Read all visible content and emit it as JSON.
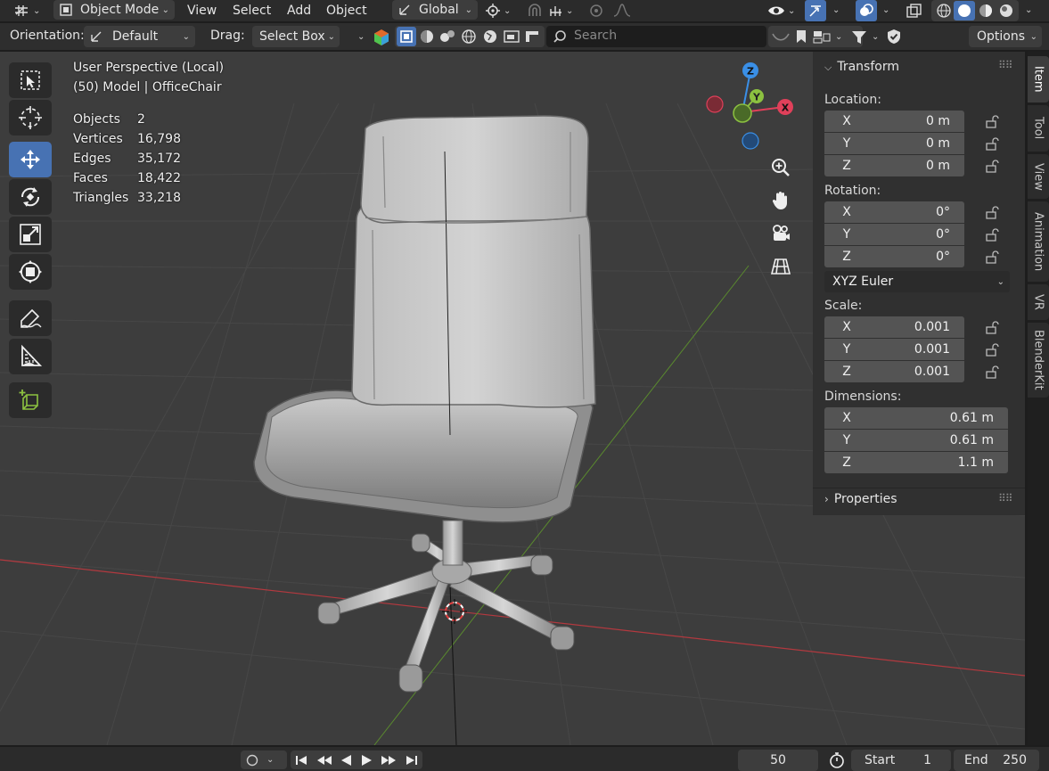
{
  "header": {
    "mode": "Object Mode",
    "menus": [
      "View",
      "Select",
      "Add",
      "Object"
    ],
    "transform_orientation": "Global"
  },
  "toolsettings": {
    "orientation_label": "Orientation:",
    "orientation_value": "Default",
    "drag_label": "Drag:",
    "drag_value": "Select Box",
    "search_placeholder": "Search",
    "options_label": "Options"
  },
  "viewport": {
    "view_name": "User Perspective (Local)",
    "object_info": "(50) Model | OfficeChair",
    "stats": [
      {
        "label": "Objects",
        "value": "2"
      },
      {
        "label": "Vertices",
        "value": "16,798"
      },
      {
        "label": "Edges",
        "value": "35,172"
      },
      {
        "label": "Faces",
        "value": "18,422"
      },
      {
        "label": "Triangles",
        "value": "33,218"
      }
    ],
    "gizmo": {
      "z": "Z",
      "y": "Y",
      "x": "X"
    }
  },
  "npanel": {
    "transform_title": "Transform",
    "location_label": "Location:",
    "location": [
      {
        "axis": "X",
        "value": "0 m"
      },
      {
        "axis": "Y",
        "value": "0 m"
      },
      {
        "axis": "Z",
        "value": "0 m"
      }
    ],
    "rotation_label": "Rotation:",
    "rotation": [
      {
        "axis": "X",
        "value": "0°"
      },
      {
        "axis": "Y",
        "value": "0°"
      },
      {
        "axis": "Z",
        "value": "0°"
      }
    ],
    "rotation_mode": "XYZ Euler",
    "scale_label": "Scale:",
    "scale": [
      {
        "axis": "X",
        "value": "0.001"
      },
      {
        "axis": "Y",
        "value": "0.001"
      },
      {
        "axis": "Z",
        "value": "0.001"
      }
    ],
    "dimensions_label": "Dimensions:",
    "dimensions": [
      {
        "axis": "X",
        "value": "0.61 m"
      },
      {
        "axis": "Y",
        "value": "0.61 m"
      },
      {
        "axis": "Z",
        "value": "1.1 m"
      }
    ],
    "properties_title": "Properties"
  },
  "sidebar_tabs": [
    "Item",
    "Tool",
    "View",
    "Animation",
    "VR",
    "BlenderKit"
  ],
  "timeline": {
    "current_frame": "50",
    "start_label": "Start",
    "start_value": "1",
    "end_label": "End",
    "end_value": "250"
  },
  "colors": {
    "accent": "#4772b3",
    "axis_x": "#e0405a",
    "axis_y": "#8cc140",
    "axis_z": "#3a8fe6"
  }
}
